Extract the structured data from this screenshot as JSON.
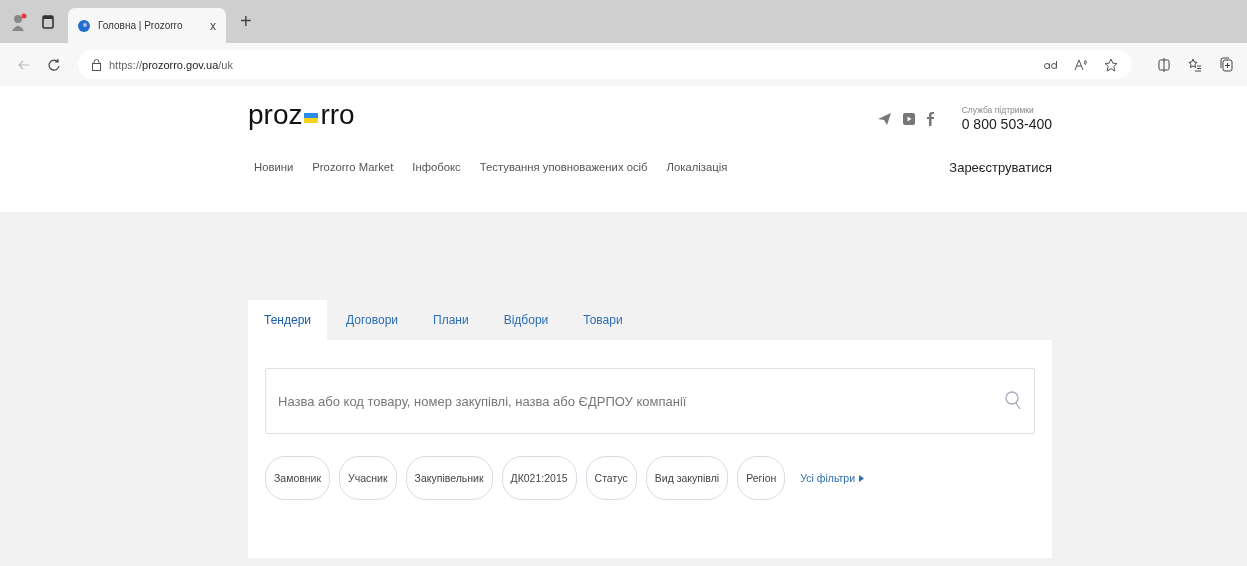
{
  "browser": {
    "tab_title": "Головна | Prozorro",
    "tab_close": "x",
    "new_tab": "+",
    "url_prefix": "https://",
    "url_host": "prozorro.gov.ua",
    "url_path": "/uk"
  },
  "header": {
    "logo": {
      "left": "proz",
      "right": "rro"
    },
    "support_label": "Служба підтримки",
    "support_phone": "0 800 503-400"
  },
  "nav": [
    "Новини",
    "Prozorro Market",
    "Інфобокс",
    "Тестування уповноважених осіб",
    "Локалізація"
  ],
  "register": "Зареєструватися",
  "tabs": [
    {
      "label": "Тендери",
      "selected": true
    },
    {
      "label": "Договори",
      "selected": false
    },
    {
      "label": "Плани",
      "selected": false
    },
    {
      "label": "Відбори",
      "selected": false
    },
    {
      "label": "Товари",
      "selected": false
    }
  ],
  "search": {
    "placeholder": "Назва або код товару, номер закупівлі, назва або ЄДРПОУ компанії"
  },
  "filters": [
    "Замовник",
    "Учасник",
    "Закупівельник",
    "ДК021:2015",
    "Статус",
    "Вид закупівлі",
    "Регіон"
  ],
  "all_filters": "Усі фільтри"
}
